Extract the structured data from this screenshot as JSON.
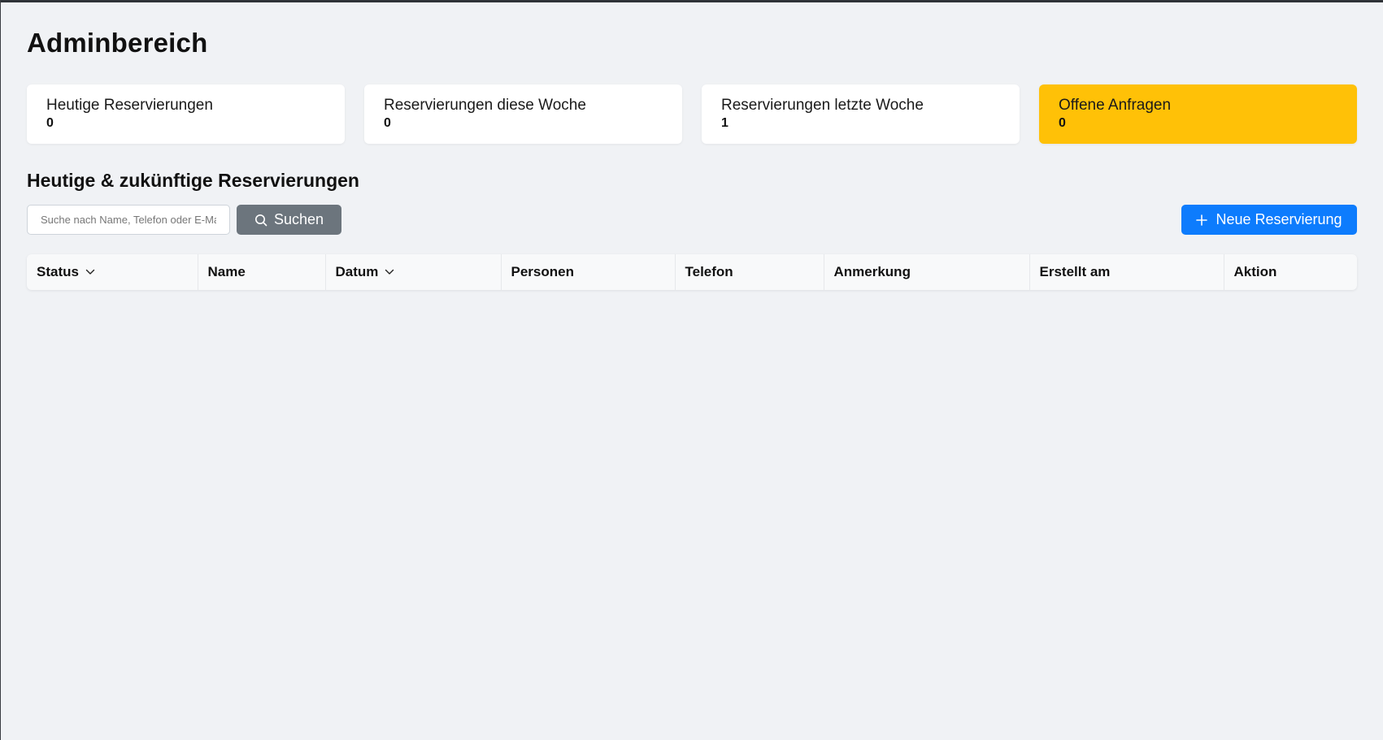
{
  "page": {
    "title": "Adminbereich"
  },
  "stats": [
    {
      "label": "Heutige Reservierungen",
      "value": "0"
    },
    {
      "label": "Reservierungen diese Woche",
      "value": "0"
    },
    {
      "label": "Reservierungen letzte Woche",
      "value": "1"
    },
    {
      "label": "Offene Anfragen",
      "value": "0",
      "highlight_color": "#ffc107"
    }
  ],
  "section": {
    "title": "Heutige & zukünftige Reservierungen"
  },
  "search": {
    "placeholder": "Suche nach Name, Telefon oder E-Mail",
    "value": "",
    "button_label": "Suchen",
    "button_icon": "search-icon",
    "button_color": "#6c757d"
  },
  "new_reservation": {
    "label": "Neue Reservierung",
    "icon": "plus-icon",
    "color": "#0d7cfd"
  },
  "table": {
    "columns": [
      {
        "label": "Status",
        "sortable": true
      },
      {
        "label": "Name",
        "sortable": false
      },
      {
        "label": "Datum",
        "sortable": true
      },
      {
        "label": "Personen",
        "sortable": false
      },
      {
        "label": "Telefon",
        "sortable": false
      },
      {
        "label": "Anmerkung",
        "sortable": false
      },
      {
        "label": "Erstellt am",
        "sortable": false
      },
      {
        "label": "Aktion",
        "sortable": false
      }
    ],
    "rows": []
  }
}
